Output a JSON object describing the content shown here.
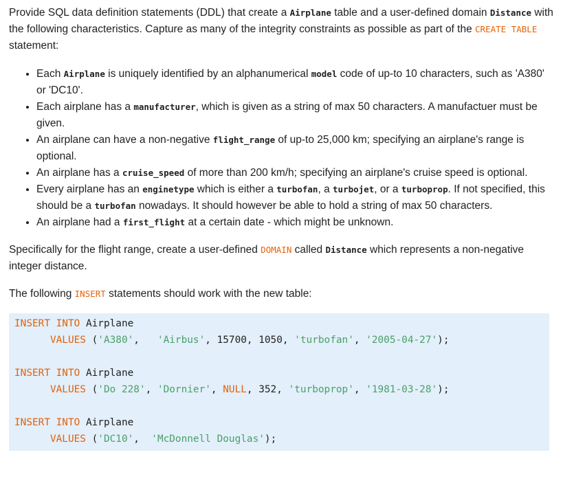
{
  "intro": {
    "t1": "Provide SQL data definition statements (DDL) that create a ",
    "airplane": "Airplane",
    "t2": " table and a user-defined domain ",
    "distance": "Distance",
    "t3": " with the following characteristics. Capture as many of the integrity constraints as possible as part of the ",
    "create_table": "CREATE TABLE",
    "t4": " statement:"
  },
  "bullets": [
    {
      "a": "Each ",
      "c1": "Airplane",
      "b": " is uniquely identified by an alphanumerical ",
      "c2": "model",
      "d": " code of up-to 10 characters, such as 'A380' or 'DC10'."
    },
    {
      "a": "Each airplane has a ",
      "c1": "manufacturer",
      "b": ", which is given as a string of max 50 characters. A manufactuer must be given."
    },
    {
      "a": "An airplane can have a non-negative ",
      "c1": "flight_range",
      "b": " of up-to 25,000 km; specifying an airplane's range is optional."
    },
    {
      "a": "An airplane has a ",
      "c1": "cruise_speed",
      "b": " of more than 200 km/h; specifying an airplane's cruise speed is optional."
    },
    {
      "a": "Every airplane has an ",
      "c1": "enginetype",
      "b": " which is either a ",
      "c2": "turbofan",
      "d": ", a ",
      "c3": "turbojet",
      "e": ", or a ",
      "c4": "turboprop",
      "f": ". If not specified, this should be a ",
      "c5": "turbofan",
      "g": " nowadays. It should however be able to hold a string of max 50 characters."
    },
    {
      "a": "An airplane had a ",
      "c1": "first_flight",
      "b": " at a certain date - which might be unknown."
    }
  ],
  "domain_para": {
    "t1": "Specifically for the flight range, create a user-defined ",
    "domain": "DOMAIN",
    "t2": " called ",
    "distance": "Distance",
    "t3": " which represents a non-negative integer distance."
  },
  "insert_para": {
    "t1": "The following ",
    "insert": "INSERT",
    "t2": " statements should work with the new table:"
  },
  "code": {
    "insert_into": "INSERT INTO",
    "table": " Airplane",
    "values": "VALUES",
    "open": " (",
    "s1": {
      "model": "'A380'",
      "manu": "'Airbus'",
      "mid": ", 15700, 1050, ",
      "engine": "'turbofan'",
      "date": "'2005-04-27'"
    },
    "s2": {
      "model": "'Do 228'",
      "manu": "'Dornier'",
      "null": "NULL",
      "mid": ", 352, ",
      "engine": "'turboprop'",
      "date": "'1981-03-28'"
    },
    "s3": {
      "model": "'DC10'",
      "manu": "'McDonnell Douglas'"
    }
  }
}
